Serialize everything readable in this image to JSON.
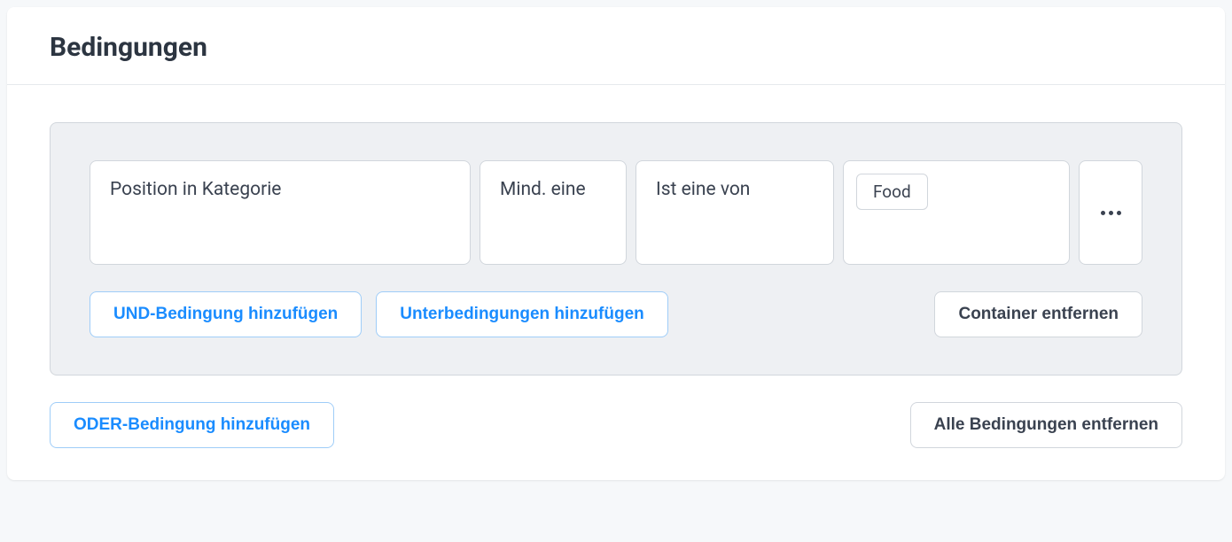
{
  "title": "Bedingungen",
  "condition": {
    "category_field": "Position in Kategorie",
    "quantifier": "Mind. eine",
    "operator": "Ist eine von",
    "values": [
      "Food"
    ]
  },
  "buttons": {
    "add_and": "UND-Bedingung hinzufügen",
    "add_sub": "Unterbedingungen hinzufügen",
    "remove_container": "Container entfernen",
    "add_or": "ODER-Bedingung hinzufügen",
    "remove_all": "Alle Bedingungen entfernen"
  }
}
